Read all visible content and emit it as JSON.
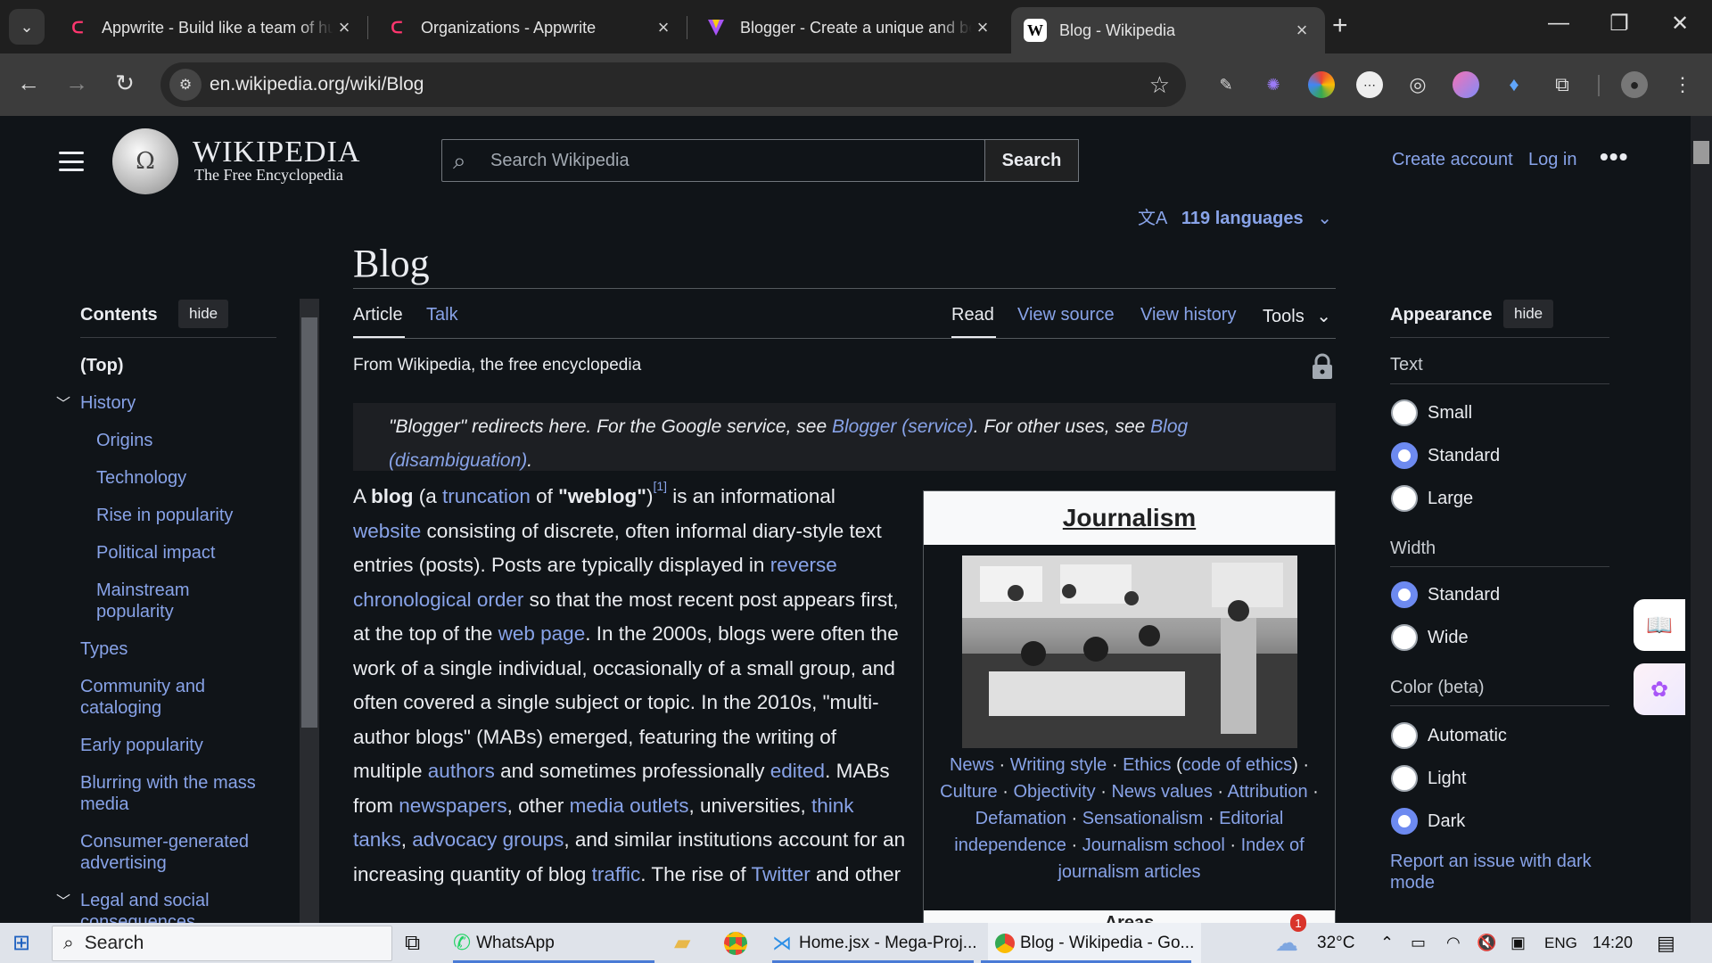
{
  "browser": {
    "tabs": [
      {
        "title": "Appwrite - Build like a team of hundreds",
        "favicon": "appwrite-icon",
        "color": "#fd366e"
      },
      {
        "title": "Organizations - Appwrite",
        "favicon": "appwrite-icon",
        "color": "#fd366e"
      },
      {
        "title": "Blogger - Create a unique and beautiful blog",
        "favicon": "blogger-icon",
        "color": "#f57d00"
      },
      {
        "title": "Blog - Wikipedia",
        "favicon": "wikipedia-icon",
        "color": "#ffffff"
      }
    ],
    "url": "en.wikipedia.org/wiki/Blog"
  },
  "wiki": {
    "wordmark": "WIKIPEDIA",
    "tagline": "The Free Encyclopedia",
    "search_placeholder": "Search Wikipedia",
    "search_button": "Search",
    "create_account": "Create account",
    "log_in": "Log in",
    "more": "•••"
  },
  "toc": {
    "heading": "Contents",
    "hide": "hide",
    "items": [
      {
        "label": "(Top)"
      },
      {
        "label": "History"
      },
      {
        "label": "Origins"
      },
      {
        "label": "Technology"
      },
      {
        "label": "Rise in popularity"
      },
      {
        "label": "Political impact"
      },
      {
        "label": "Mainstream popularity"
      },
      {
        "label": "Types"
      },
      {
        "label": "Community and cataloging"
      },
      {
        "label": "Early popularity"
      },
      {
        "label": "Blurring with the mass media"
      },
      {
        "label": "Consumer-generated advertising"
      },
      {
        "label": "Legal and social consequences"
      }
    ]
  },
  "article": {
    "title": "Blog",
    "languages": "119 languages",
    "tabs": {
      "article": "Article",
      "talk": "Talk",
      "read": "Read",
      "view_source": "View source",
      "view_history": "View history",
      "tools": "Tools"
    },
    "from": "From Wikipedia, the free encyclopedia",
    "hatnote": {
      "t1": "\"Blogger\" redirects here. For the Google service, see ",
      "l1": "Blogger (service)",
      "t2": ". For other uses, see ",
      "l2": "Blog (disambiguation)",
      "t3": "."
    },
    "body": {
      "s1": "A ",
      "b1": "blog",
      "s2": " (a ",
      "l_truncation": "truncation",
      "s3": " of ",
      "b2": "\"weblog\"",
      "s3b": ")",
      "ref": "[1]",
      "s4": " is an informational ",
      "l_website": "website",
      "s5": " consisting of discrete, often informal diary-style text entries (posts). Posts are typically displayed in ",
      "l_rco": "reverse chronological order",
      "s6": " so that the most recent post appears first, at the top of the ",
      "l_webpage": "web page",
      "s7": ". In the 2000s, blogs were often the work of a single individual, occasionally of a small group, and often covered a single subject or topic. In the 2010s, \"multi-author blogs\" (MABs) emerged, featuring the writing of multiple ",
      "l_authors": "authors",
      "s8": " and sometimes professionally ",
      "l_edited": "edited",
      "s9": ". MABs from ",
      "l_newspapers": "newspapers",
      "s10": ", other ",
      "l_media": "media outlets",
      "s11": ", universities, ",
      "l_think": "think tanks",
      "s12": ", ",
      "l_advocacy": "advocacy groups",
      "s13": ", and similar institutions account for an increasing quantity of blog ",
      "l_traffic": "traffic",
      "s14": ". The rise of ",
      "l_twitter": "Twitter",
      "s15": " and other"
    },
    "infobox": {
      "title": "Journalism",
      "links": [
        "News",
        "Writing style",
        "Ethics",
        "code of ethics",
        "Culture",
        "Objectivity",
        "News values",
        "Attribution",
        "Defamation",
        "Sensationalism",
        "Editorial independence",
        "Journalism school",
        "Index of journalism articles"
      ],
      "areas": "Areas"
    }
  },
  "appearance": {
    "heading": "Appearance",
    "hide": "hide",
    "text_label": "Text",
    "text_options": [
      {
        "label": "Small",
        "selected": false
      },
      {
        "label": "Standard",
        "selected": true
      },
      {
        "label": "Large",
        "selected": false
      }
    ],
    "width_label": "Width",
    "width_options": [
      {
        "label": "Standard",
        "selected": true
      },
      {
        "label": "Wide",
        "selected": false
      }
    ],
    "color_label": "Color (beta)",
    "color_options": [
      {
        "label": "Automatic",
        "selected": false
      },
      {
        "label": "Light",
        "selected": false
      },
      {
        "label": "Dark",
        "selected": true
      }
    ],
    "report": "Report an issue with dark mode"
  },
  "taskbar": {
    "search": "Search",
    "whatsapp": "WhatsApp",
    "vscode": "Home.jsx - Mega-Proj...",
    "chrome": "Blog - Wikipedia - Go...",
    "weather_badge": "1",
    "temperature": "32°C",
    "lang": "ENG",
    "time": "14:20"
  },
  "colors": {
    "link": "#88a3e8",
    "background": "#101418",
    "accent_radio": "#6d8af0"
  }
}
